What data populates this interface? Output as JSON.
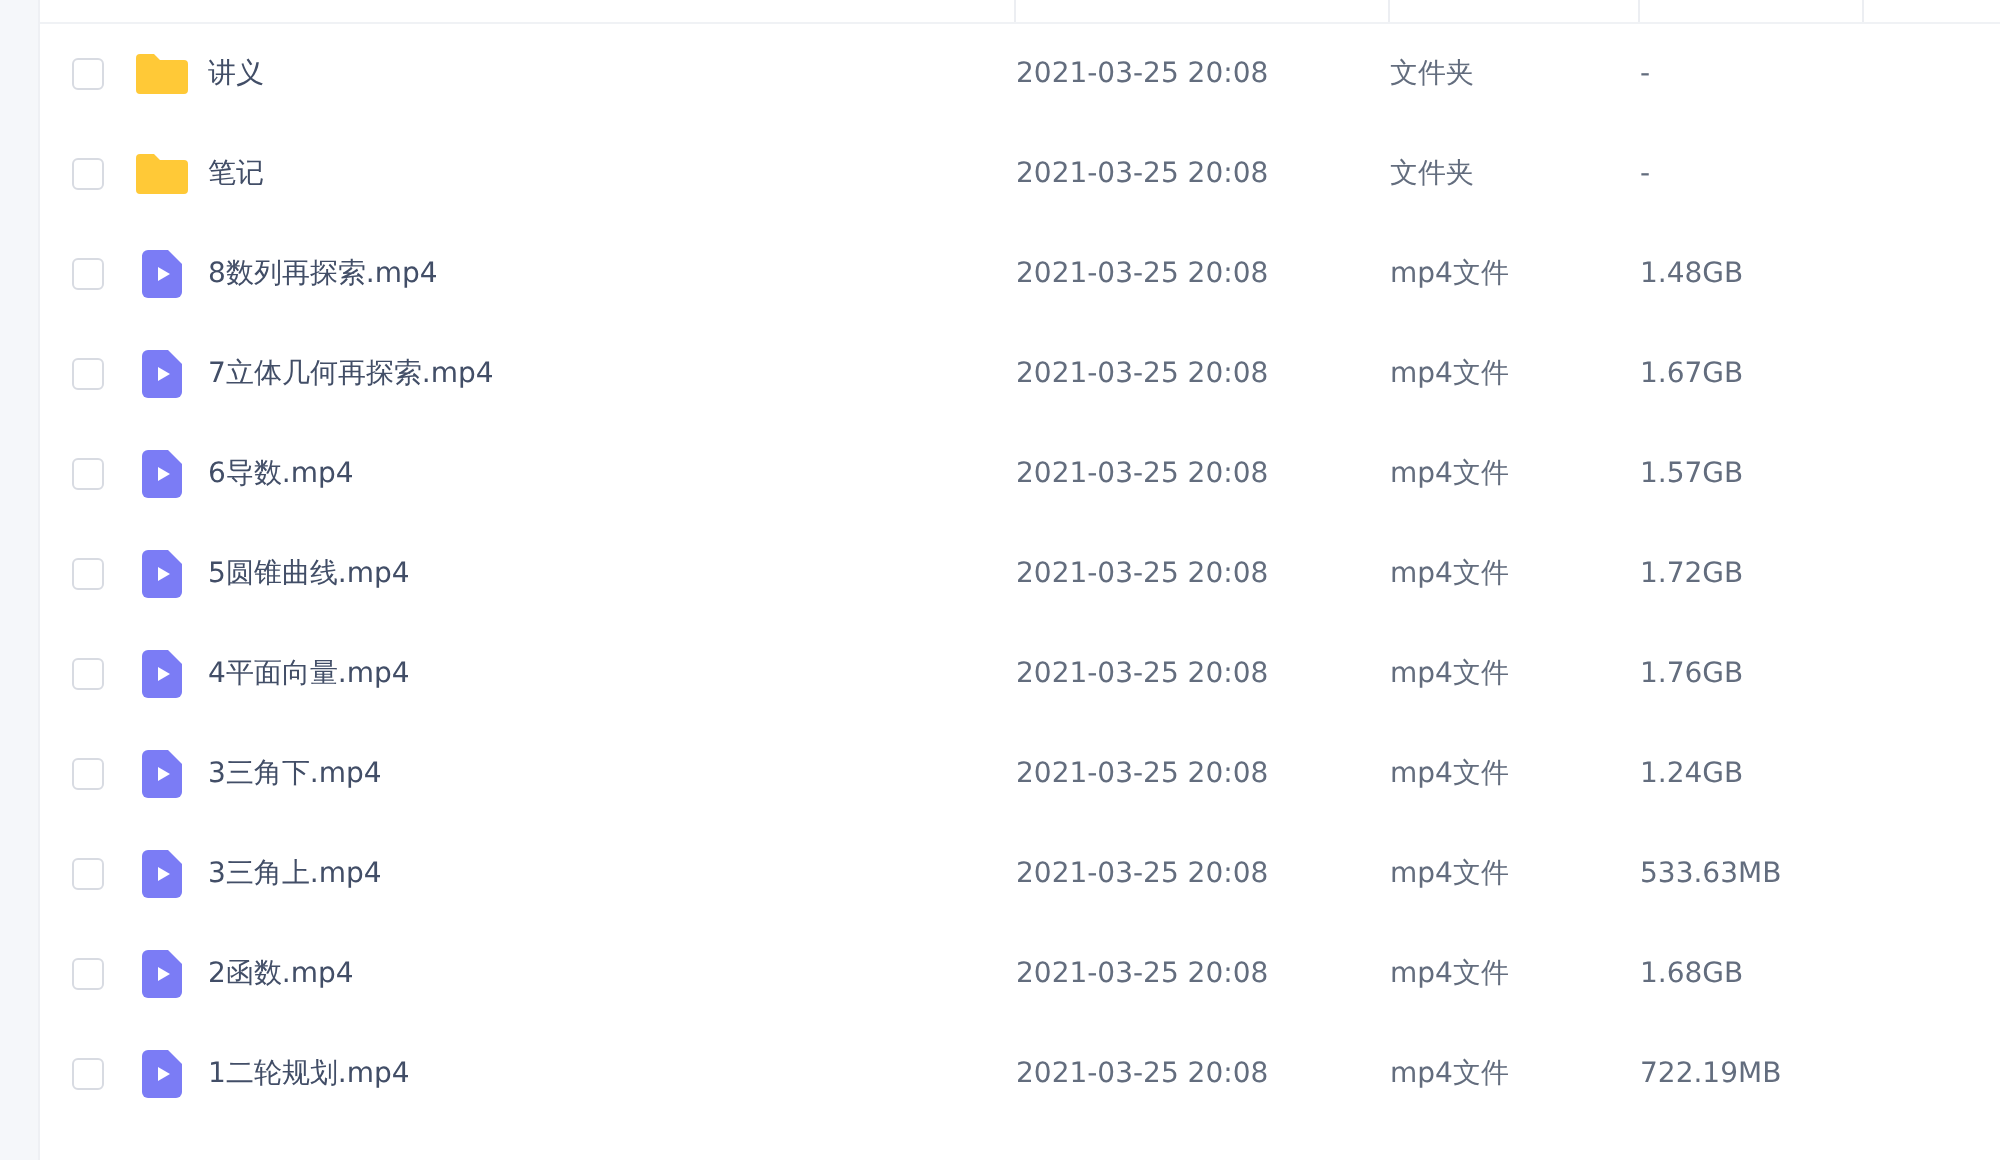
{
  "files": [
    {
      "kind": "folder",
      "checked": false,
      "name": "讲义",
      "modified": "2021-03-25 20:08",
      "type": "文件夹",
      "size": "-"
    },
    {
      "kind": "folder",
      "checked": false,
      "name": "笔记",
      "modified": "2021-03-25 20:08",
      "type": "文件夹",
      "size": "-"
    },
    {
      "kind": "video",
      "checked": false,
      "name": "8数列再探索.mp4",
      "modified": "2021-03-25 20:08",
      "type": "mp4文件",
      "size": "1.48GB"
    },
    {
      "kind": "video",
      "checked": false,
      "name": "7立体几何再探索.mp4",
      "modified": "2021-03-25 20:08",
      "type": "mp4文件",
      "size": "1.67GB"
    },
    {
      "kind": "video",
      "checked": false,
      "name": "6导数.mp4",
      "modified": "2021-03-25 20:08",
      "type": "mp4文件",
      "size": "1.57GB"
    },
    {
      "kind": "video",
      "checked": false,
      "name": "5圆锥曲线.mp4",
      "modified": "2021-03-25 20:08",
      "type": "mp4文件",
      "size": "1.72GB"
    },
    {
      "kind": "video",
      "checked": false,
      "name": "4平面向量.mp4",
      "modified": "2021-03-25 20:08",
      "type": "mp4文件",
      "size": "1.76GB"
    },
    {
      "kind": "video",
      "checked": false,
      "name": "3三角下.mp4",
      "modified": "2021-03-25 20:08",
      "type": "mp4文件",
      "size": "1.24GB"
    },
    {
      "kind": "video",
      "checked": false,
      "name": "3三角上.mp4",
      "modified": "2021-03-25 20:08",
      "type": "mp4文件",
      "size": "533.63MB"
    },
    {
      "kind": "video",
      "checked": false,
      "name": "2函数.mp4",
      "modified": "2021-03-25 20:08",
      "type": "mp4文件",
      "size": "1.68GB"
    },
    {
      "kind": "video",
      "checked": false,
      "name": "1二轮规划.mp4",
      "modified": "2021-03-25 20:08",
      "type": "mp4文件",
      "size": "722.19MB"
    }
  ]
}
